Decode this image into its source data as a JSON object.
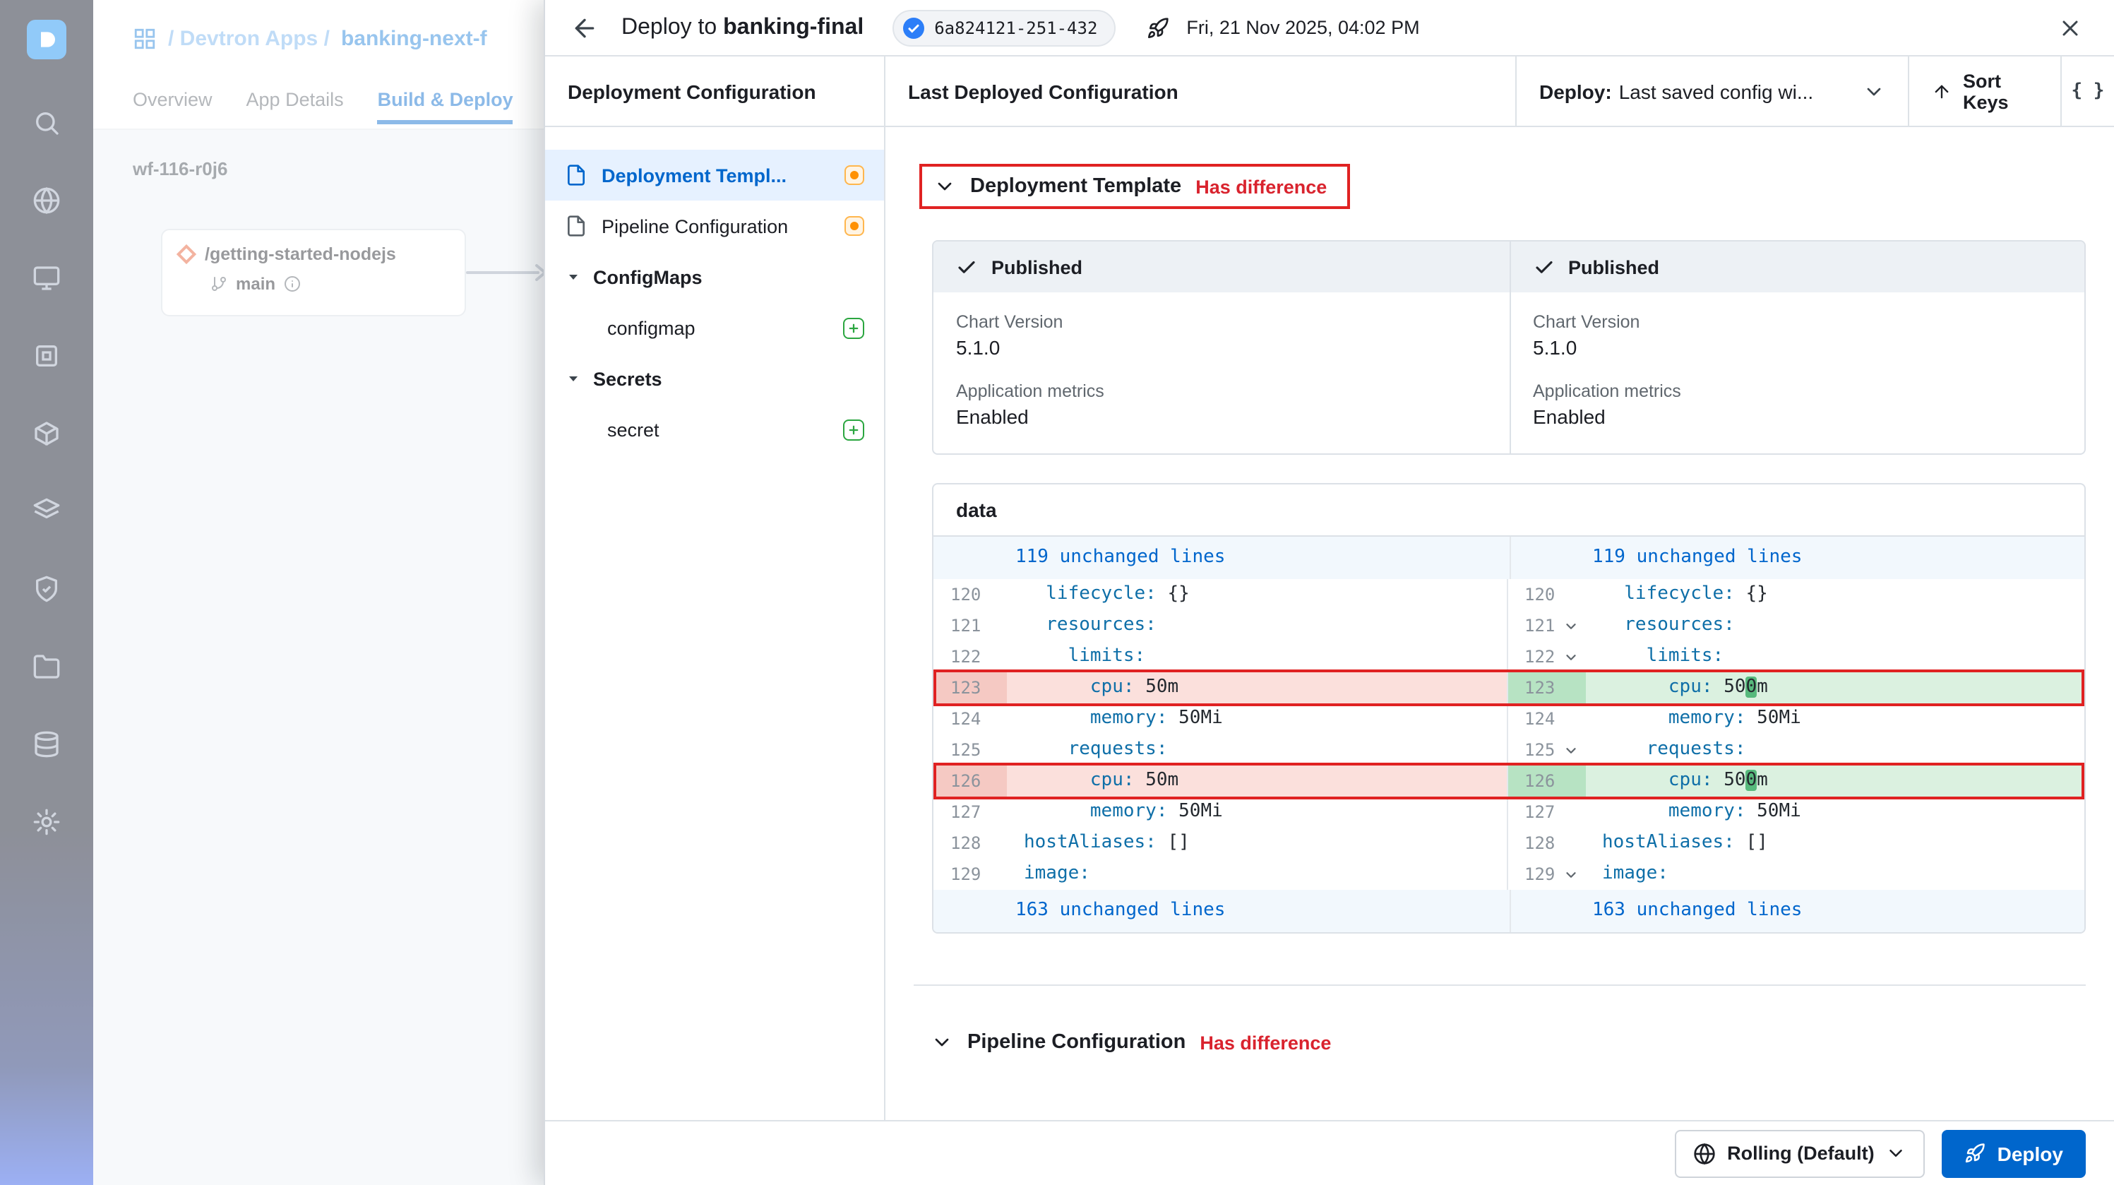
{
  "colors": {
    "accent_blue": "#0066cc",
    "difference_red": "#d9232e",
    "added_green": "#2ba640",
    "drift_orange": "#ff9102"
  },
  "background": {
    "breadcrumb_prefix": "/ Devtron Apps /",
    "breadcrumb_app": "banking-next-f",
    "tab_overview": "Overview",
    "tab_app_details": "App Details",
    "tab_build_deploy": "Build & Deploy",
    "workflow_id": "wf-116-r0j6",
    "repo_name": "/getting-started-nodejs",
    "branch_name": "main"
  },
  "header": {
    "title_prefix": "Deploy to",
    "title_app": "banking-final",
    "image_tag": "6a824121-251-432",
    "datetime": "Fri, 21 Nov 2025, 04:02 PM"
  },
  "toolbar": {
    "config_title": "Deployment Configuration",
    "last_deployed_title": "Last Deployed Configuration",
    "deploy_label": "Deploy:",
    "deploy_value": "Last saved config wi...",
    "sort_keys": "Sort Keys",
    "code_view": "{ }"
  },
  "nav": {
    "deployment_template": "Deployment Templ...",
    "pipeline_configuration": "Pipeline Configuration",
    "configmaps": "ConfigMaps",
    "configmap": "configmap",
    "secrets": "Secrets",
    "secret": "secret"
  },
  "sections": {
    "deployment_template": {
      "title": "Deployment Template",
      "badge": "Has difference"
    },
    "pipeline": {
      "title": "Pipeline Configuration",
      "badge": "Has difference"
    }
  },
  "published": {
    "left": {
      "status": "Published",
      "chart_version_label": "Chart Version",
      "chart_version": "5.1.0",
      "metrics_label": "Application metrics",
      "metrics_value": "Enabled"
    },
    "right": {
      "status": "Published",
      "chart_version_label": "Chart Version",
      "chart_version": "5.1.0",
      "metrics_label": "Application metrics",
      "metrics_value": "Enabled"
    }
  },
  "diff": {
    "title": "data",
    "rows": [
      {
        "type": "banner",
        "left_text": "119 unchanged lines",
        "right_text": "119 unchanged lines"
      },
      {
        "type": "code",
        "no": "120",
        "indent": 2,
        "key": "lifecycle:",
        "left_val": "{}",
        "right_val": "{}"
      },
      {
        "type": "code",
        "no": "121",
        "indent": 2,
        "key": "resources:",
        "fold": true
      },
      {
        "type": "code",
        "no": "122",
        "indent": 4,
        "key": "limits:",
        "fold": true
      },
      {
        "type": "changed",
        "no": "123",
        "indent": 6,
        "key": "cpu:",
        "left_val": "50m",
        "right_pre": "50",
        "right_hl": "0",
        "right_post": "m",
        "boxed": true
      },
      {
        "type": "code",
        "no": "124",
        "indent": 6,
        "key": "memory:",
        "left_val": "50Mi",
        "right_val": "50Mi"
      },
      {
        "type": "code",
        "no": "125",
        "indent": 4,
        "key": "requests:",
        "fold": true
      },
      {
        "type": "changed",
        "no": "126",
        "indent": 6,
        "key": "cpu:",
        "left_val": "50m",
        "right_pre": "50",
        "right_hl": "0",
        "right_post": "m",
        "boxed": true
      },
      {
        "type": "code",
        "no": "127",
        "indent": 6,
        "key": "memory:",
        "left_val": "50Mi",
        "right_val": "50Mi"
      },
      {
        "type": "code",
        "no": "128",
        "indent": 0,
        "key": "hostAliases:",
        "left_val": "[]",
        "right_val": "[]"
      },
      {
        "type": "code",
        "no": "129",
        "indent": 0,
        "key": "image:",
        "fold": true
      },
      {
        "type": "banner",
        "left_text": "163 unchanged lines",
        "right_text": "163 unchanged lines"
      }
    ]
  },
  "footer": {
    "strategy": "Rolling (Default)",
    "deploy": "Deploy"
  }
}
